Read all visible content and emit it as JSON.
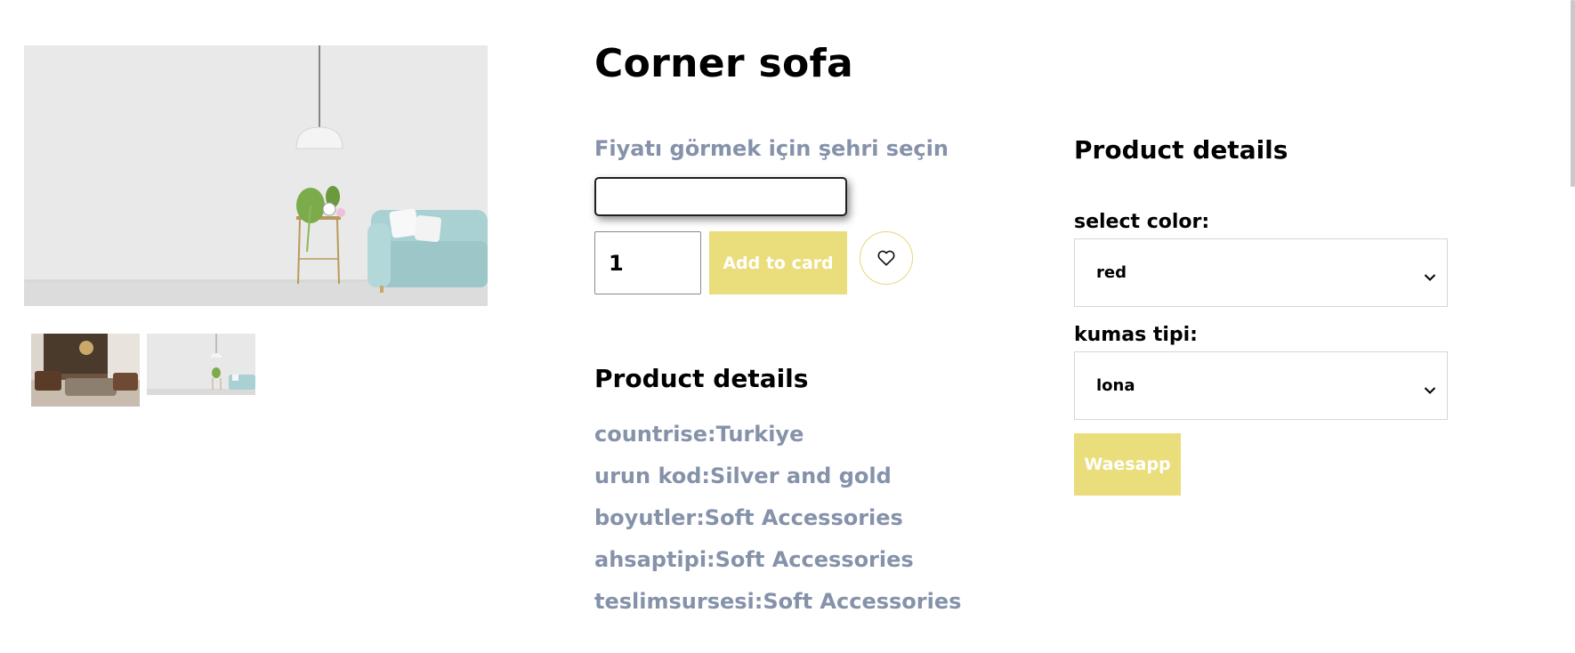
{
  "product": {
    "title": "Corner sofa",
    "city_label": "Fiyatı görmek için şehri seçin",
    "city_input_value": "",
    "quantity": "1",
    "add_to_cart_label": "Add to card",
    "wishlist_icon": "heart-icon"
  },
  "details_left": {
    "title": "Product details",
    "lines": [
      "countrise:Turkiye",
      "urun kod:Silver and gold",
      "boyutler:Soft Accessories",
      "ahsaptipi:Soft Accessories",
      "teslimsursesi:Soft Accessories"
    ]
  },
  "details_right": {
    "title": "Product details",
    "color_label": "select color:",
    "color_value": "red",
    "fabric_label": "kumas tipi:",
    "fabric_value": "lona",
    "whatsapp_label": "Waesapp"
  },
  "colors": {
    "accent_yellow": "#eadd7b",
    "muted_text": "#8592aa"
  }
}
